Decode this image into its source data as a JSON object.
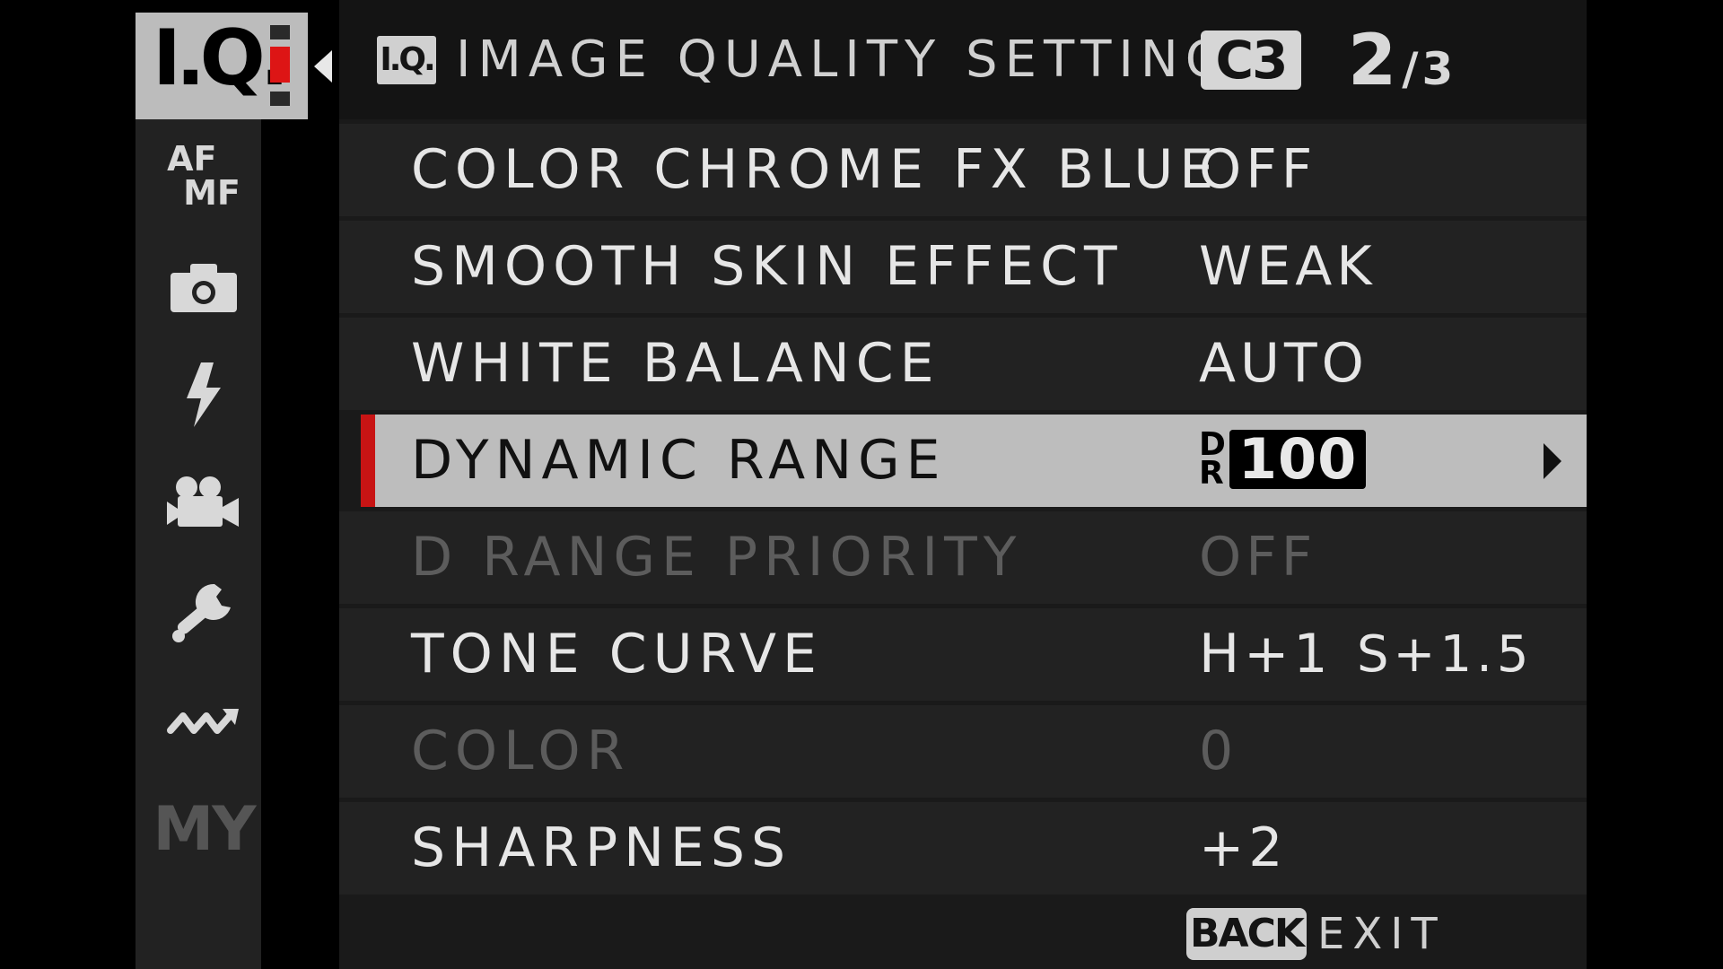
{
  "sidebar": {
    "selected_tab": {
      "label": "I.Q.",
      "icon": "image-quality-icon"
    },
    "tabs": [
      {
        "name": "af-mf",
        "line1": "AF",
        "line2": "MF"
      },
      {
        "name": "shooting-settings",
        "icon": "camera-icon"
      },
      {
        "name": "flash-settings",
        "icon": "flash-icon"
      },
      {
        "name": "movie-settings",
        "icon": "movie-camera-icon"
      },
      {
        "name": "set-up",
        "icon": "wrench-icon"
      },
      {
        "name": "connection-settings",
        "icon": "wireless-icon"
      },
      {
        "name": "my-menu",
        "label": "MY"
      }
    ]
  },
  "header": {
    "badge": "I.Q.",
    "title": "IMAGE QUALITY SETTING",
    "custom_slot": "C3",
    "page_current": "2",
    "page_total": "/3"
  },
  "menu": {
    "items": [
      {
        "label": "COLOR CHROME FX BLUE",
        "value": "OFF"
      },
      {
        "label": "SMOOTH SKIN EFFECT",
        "value": "WEAK"
      },
      {
        "label": "WHITE BALANCE",
        "value": "AUTO"
      },
      {
        "label": "DYNAMIC RANGE",
        "value_prefix_top": "D",
        "value_prefix_bottom": "R",
        "value": "100"
      },
      {
        "label": "D RANGE PRIORITY",
        "value": "OFF"
      },
      {
        "label": "TONE CURVE",
        "value": "H+1",
        "value2": "S+1.5"
      },
      {
        "label": "COLOR",
        "value": "0"
      },
      {
        "label": "SHARPNESS",
        "value": "+2"
      }
    ]
  },
  "footer": {
    "back_label": "BACK",
    "exit_label": "EXIT"
  },
  "colors": {
    "accent_red": "#c81414",
    "selected_row": "#bdbdbd",
    "disabled_text": "#5c5c5c"
  }
}
